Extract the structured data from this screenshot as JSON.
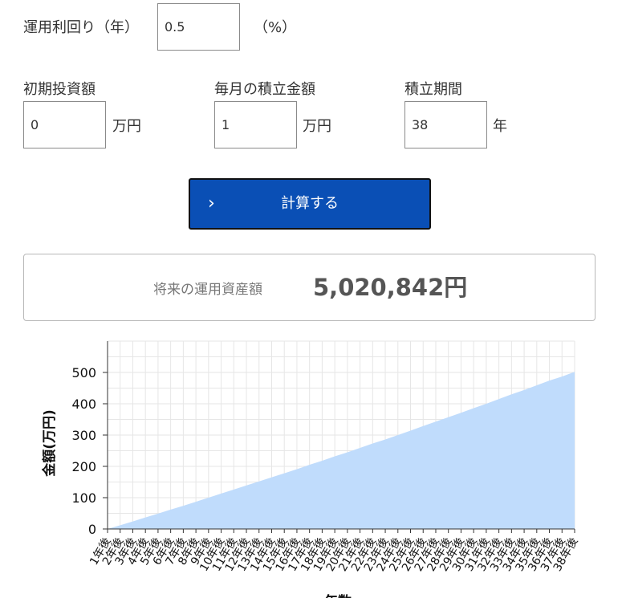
{
  "rate": {
    "label": "運用利回り（年）",
    "value": "0.5",
    "unit": "（%）"
  },
  "initial": {
    "label": "初期投資額",
    "value": "0",
    "unit": "万円"
  },
  "monthly": {
    "label": "毎月の積立金額",
    "value": "1",
    "unit": "万円"
  },
  "period": {
    "label": "積立期間",
    "value": "38",
    "unit": "年"
  },
  "calc_button": {
    "label": "計算する",
    "icon": "chevron-right-icon"
  },
  "result": {
    "label": "将来の運用資産額",
    "value": "5,020,842円"
  },
  "colors": {
    "button": "#0a4fb5",
    "area_fill": "#c0dcfc",
    "grid": "#e6e6e6"
  },
  "chart_data": {
    "type": "area",
    "ylabel": "金額(万円)",
    "xlabel": "年数",
    "ylim": [
      0,
      600
    ],
    "yticks": [
      0,
      100,
      200,
      300,
      400,
      500
    ],
    "grid": true,
    "categories": [
      "1年後",
      "2年後",
      "3年後",
      "4年後",
      "5年後",
      "6年後",
      "7年後",
      "8年後",
      "9年後",
      "10年後",
      "11年後",
      "12年後",
      "13年後",
      "14年後",
      "15年後",
      "16年後",
      "17年後",
      "18年後",
      "19年後",
      "20年後",
      "21年後",
      "22年後",
      "23年後",
      "24年後",
      "25年後",
      "26年後",
      "27年後",
      "28年後",
      "29年後",
      "30年後",
      "31年後",
      "32年後",
      "33年後",
      "34年後",
      "35年後",
      "36年後",
      "37年後",
      "38年後"
    ],
    "series": [
      {
        "values": [
          0,
          12,
          24,
          37,
          49,
          62,
          74,
          87,
          100,
          113,
          126,
          139,
          152,
          165,
          178,
          191,
          205,
          218,
          232,
          245,
          259,
          273,
          286,
          300,
          314,
          329,
          343,
          357,
          371,
          386,
          400,
          415,
          430,
          444,
          459,
          474,
          487,
          502
        ]
      }
    ]
  }
}
